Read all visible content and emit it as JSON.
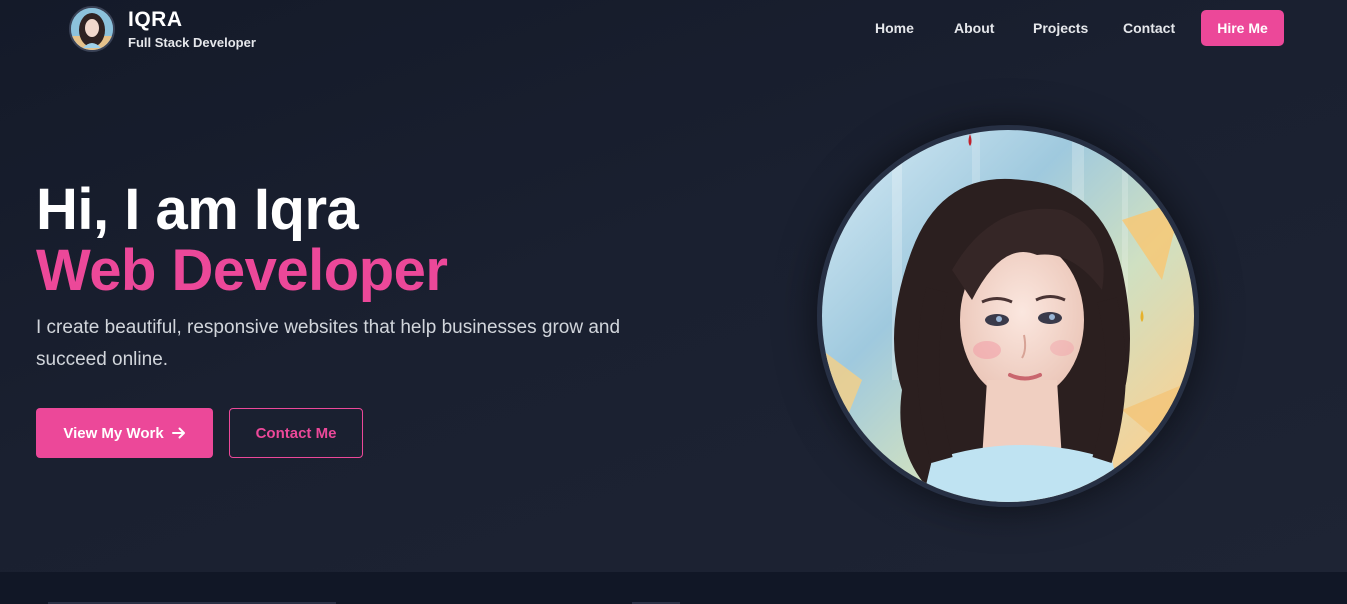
{
  "brand": {
    "name": "IQRA",
    "role": "Full Stack Developer"
  },
  "nav": {
    "items": [
      {
        "label": "Home"
      },
      {
        "label": "About"
      },
      {
        "label": "Projects"
      },
      {
        "label": "Contact"
      }
    ],
    "cta_label": "Hire Me"
  },
  "hero": {
    "greeting": "Hi, I am Iqra",
    "title": "Web Developer",
    "description": "I create beautiful, responsive websites that help businesses grow and succeed online.",
    "primary_button": "View My Work",
    "secondary_button": "Contact Me"
  },
  "colors": {
    "accent": "#ec4899",
    "background": "#1a1f2e",
    "text": "#ffffff",
    "muted": "#d1d5db"
  },
  "icons": {
    "primary_button_icon": "arrow-right-icon"
  }
}
